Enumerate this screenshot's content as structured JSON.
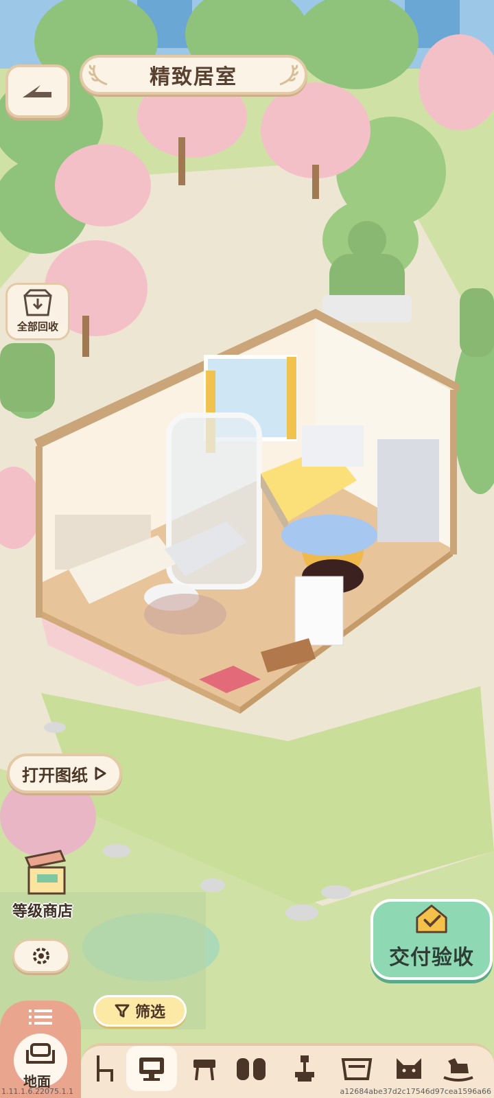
{
  "header": {
    "title": "精致居室"
  },
  "buttons": {
    "recycle_all": "全部回收",
    "open_blueprint": "打开图纸",
    "level_shop": "等级商店",
    "deliver": "交付验收",
    "filter": "筛选",
    "floor": "地面"
  },
  "footer": {
    "version": "1.11.1.6.22075.1.1",
    "hash": "a12684abe37d2c17546d97cea1596a66"
  },
  "categories": [
    "chair-icon",
    "monitor-desk-icon",
    "table-icon",
    "bookshelf-icon",
    "lamp-icon",
    "cabinet-icon",
    "cat-icon",
    "rocking-horse-icon"
  ],
  "colors": {
    "accent_green": "#8fd8b4",
    "tab_active": "#e9a58e",
    "banner": "#fbf4e6"
  }
}
